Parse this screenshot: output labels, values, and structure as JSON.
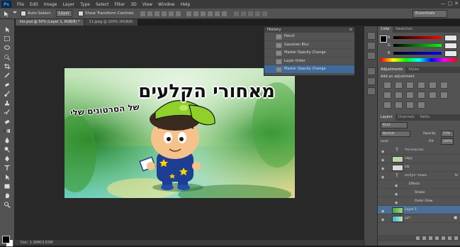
{
  "app": {
    "logo": "Ps"
  },
  "menu": [
    "File",
    "Edit",
    "Image",
    "Layer",
    "Type",
    "Select",
    "Filter",
    "3D",
    "View",
    "Window",
    "Help"
  ],
  "window_controls": [
    "—",
    "□",
    "✕"
  ],
  "options": {
    "auto_select_label": "Auto-Select:",
    "auto_select_value": "Layer",
    "transform_label": "Show Transform Controls",
    "workspace": "Essentials"
  },
  "doc_tabs": [
    {
      "label": "ktz.psd @ 50% (Layer 1, RGB/8) *",
      "active": true
    },
    {
      "label": "11.jpeg @ 100% (RGB/8)",
      "active": false
    }
  ],
  "artwork": {
    "title_text": "מאחורי הקלעים",
    "subtitle_text": "של הסרטונים שלי",
    "colors": {
      "cap": "#8fd12a",
      "shirt": "#1e3e94",
      "star": "#ffd200",
      "title": "#111111"
    }
  },
  "status": {
    "text": "Doc: 1.99M/3.63M"
  },
  "history": {
    "title": "History",
    "items": [
      {
        "label": "Pencil",
        "active": false
      },
      {
        "label": "Gaussian Blur",
        "active": false
      },
      {
        "label": "Master Opacity Change",
        "active": false
      },
      {
        "label": "Layer Order",
        "active": false
      },
      {
        "label": "Master Opacity Change",
        "active": true
      }
    ]
  },
  "color_panel": {
    "tabs": [
      "Color",
      "Swatches"
    ],
    "labels": [
      "R",
      "G",
      "B"
    ],
    "channel_values": [
      0,
      0,
      0
    ]
  },
  "adjustments": {
    "tabs": [
      "Adjustments",
      "Styles"
    ],
    "heading": "Add an adjustment"
  },
  "layers": {
    "tabs": [
      "Layers",
      "Channels",
      "Paths"
    ],
    "kind_label": "Kind",
    "blend_mode": "Normal",
    "opacity_label": "Opacity:",
    "opacity_value": "73%",
    "lock_label": "Lock:",
    "fill_label": "Fill:",
    "fill_value": "100%",
    "rows": [
      {
        "name": "הסרטונים שלי",
        "type": "text",
        "active": false,
        "sub": false
      },
      {
        "name": "copy",
        "type": "image",
        "active": false,
        "sub": false
      },
      {
        "name": "ktz",
        "type": "image",
        "active": false,
        "sub": false
      },
      {
        "name": "מאחורי הקלעים",
        "type": "text",
        "active": false,
        "sub": false
      },
      {
        "name": "Effects",
        "type": "effects",
        "active": false,
        "sub": true
      },
      {
        "name": "Stroke",
        "type": "effect",
        "active": false,
        "sub": true
      },
      {
        "name": "Outer Glow",
        "type": "effect",
        "active": false,
        "sub": true
      },
      {
        "name": "Layer 1",
        "type": "image",
        "active": true,
        "sub": false
      },
      {
        "name": "רקע",
        "type": "background",
        "active": false,
        "sub": false
      }
    ]
  },
  "icons": {
    "tools": [
      "move-icon",
      "marquee-icon",
      "lasso-icon",
      "quick-select-icon",
      "crop-icon",
      "eyedropper-icon",
      "healing-icon",
      "brush-icon",
      "stamp-icon",
      "history-brush-icon",
      "eraser-icon",
      "gradient-icon",
      "blur-icon",
      "dodge-icon",
      "pen-icon",
      "type-icon",
      "path-select-icon",
      "shape-icon",
      "hand-icon",
      "zoom-icon"
    ]
  }
}
